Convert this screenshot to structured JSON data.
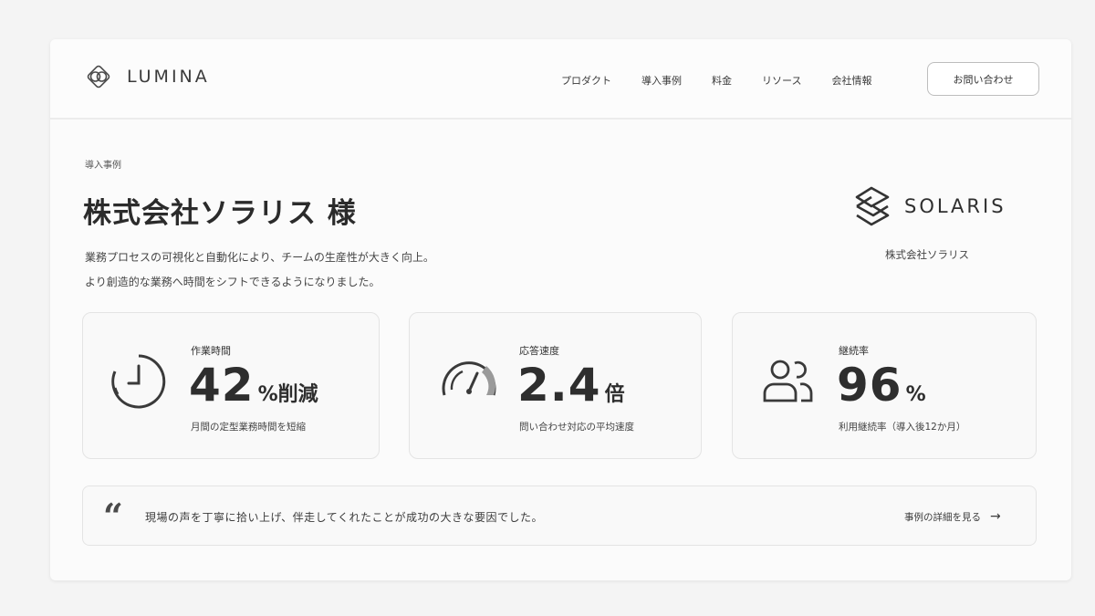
{
  "brand": {
    "name": "LUMINA",
    "icon": "lumina-logo-icon"
  },
  "nav": {
    "items": [
      "プロダクト",
      "導入事例",
      "料金",
      "リソース",
      "会社情報"
    ],
    "contact_label": "お問い合わせ"
  },
  "hero": {
    "eyebrow": "導入事例",
    "title": "株式会社ソラリス 様",
    "lead_line1": "業務プロセスの可視化と自動化により、チームの生産性が大きく向上。",
    "lead_line2": "より創造的な業務へ時間をシフトできるようになりました。"
  },
  "client": {
    "logo_text": "SOLARIS",
    "caption": "株式会社ソラリス",
    "icon": "solaris-logo-icon"
  },
  "stats": [
    {
      "label": "作業時間",
      "number": "42",
      "unit": "%削減",
      "desc": "月間の定型業務時間を短縮",
      "icon": "clock-icon"
    },
    {
      "label": "応答速度",
      "number": "2.4",
      "unit": "倍",
      "desc": "問い合わせ対応の平均速度",
      "icon": "speedometer-icon"
    },
    {
      "label": "継続率",
      "number": "96",
      "unit": "%",
      "desc": "利用継続率（導入後12か月）",
      "icon": "users-icon"
    }
  ],
  "quote": {
    "mark": "“",
    "text": "現場の声を丁寧に拾い上げ、伴走してくれたことが成功の大きな要因でした。",
    "link_label": "事例の詳細を見る",
    "arrow": "→"
  },
  "colors": {
    "background": "#f4f4f4",
    "card": "#f9f9f9",
    "border": "#e4e4e4",
    "text": "#2e2e2e"
  }
}
